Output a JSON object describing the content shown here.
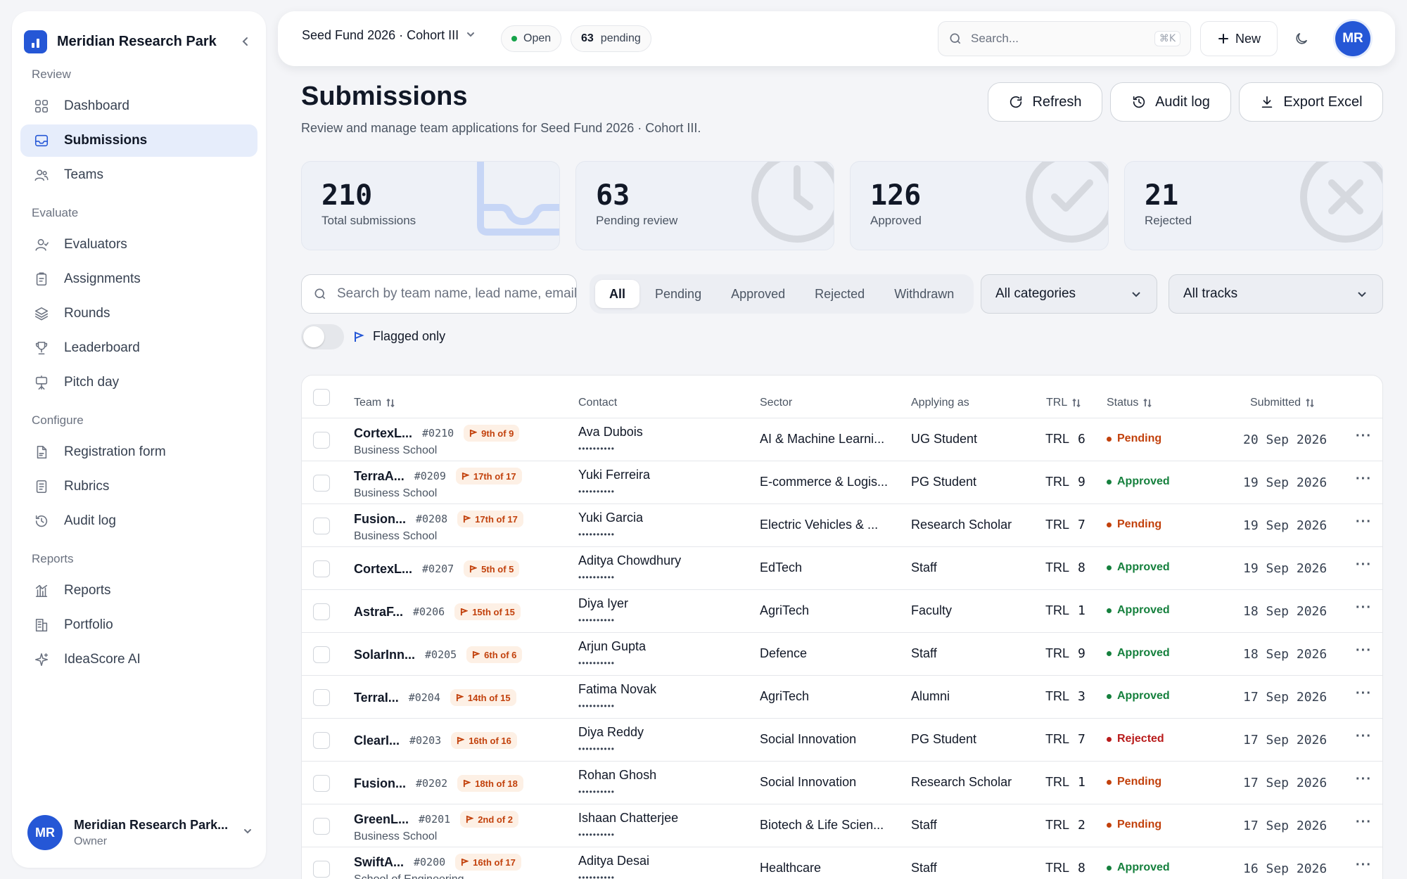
{
  "sidebar": {
    "brand": "Meridian Research Park",
    "groups": [
      {
        "label": "Review",
        "items": [
          {
            "label": "Dashboard",
            "icon": "dashboard-icon",
            "active": false
          },
          {
            "label": "Submissions",
            "icon": "inbox-icon",
            "active": true
          },
          {
            "label": "Teams",
            "icon": "users-icon",
            "active": false
          }
        ]
      },
      {
        "label": "Evaluate",
        "items": [
          {
            "label": "Evaluators",
            "icon": "user-icon",
            "active": false
          },
          {
            "label": "Assignments",
            "icon": "clipboard-icon",
            "active": false
          },
          {
            "label": "Rounds",
            "icon": "layers-icon",
            "active": false
          },
          {
            "label": "Leaderboard",
            "icon": "trophy-icon",
            "active": false
          },
          {
            "label": "Pitch day",
            "icon": "presentation-icon",
            "active": false
          }
        ]
      },
      {
        "label": "Configure",
        "items": [
          {
            "label": "Registration form",
            "icon": "form-icon",
            "active": false
          },
          {
            "label": "Rubrics",
            "icon": "rubric-icon",
            "active": false
          },
          {
            "label": "Audit log",
            "icon": "history-icon",
            "active": false
          }
        ]
      },
      {
        "label": "Reports",
        "items": [
          {
            "label": "Reports",
            "icon": "chart-icon",
            "active": false
          },
          {
            "label": "Portfolio",
            "icon": "building-icon",
            "active": false
          },
          {
            "label": "IdeaScore AI",
            "icon": "sparkle-icon",
            "active": false
          }
        ]
      }
    ],
    "profile": {
      "initials": "MR",
      "name": "Meridian Research Park...",
      "role": "Owner"
    }
  },
  "topbar": {
    "fund": "Seed Fund 2026 · Cohort III",
    "status": "Open",
    "pending_count": "63",
    "pending_label": "pending",
    "search_placeholder": "Search...",
    "shortcut": "⌘K",
    "new_label": "New",
    "avatar": "MR"
  },
  "header": {
    "title": "Submissions",
    "subtitle": "Review and manage team applications for Seed Fund 2026 · Cohort III.",
    "refresh": "Refresh",
    "audit": "Audit log",
    "export": "Export Excel"
  },
  "stats": [
    {
      "value": "210",
      "label": "Total submissions"
    },
    {
      "value": "63",
      "label": "Pending review"
    },
    {
      "value": "126",
      "label": "Approved"
    },
    {
      "value": "21",
      "label": "Rejected"
    }
  ],
  "filters": {
    "search_placeholder": "Search by team name, lead name, email",
    "tabs": [
      "All",
      "Pending",
      "Approved",
      "Rejected",
      "Withdrawn"
    ],
    "active_tab": "All",
    "category": "All categories",
    "track": "All tracks",
    "flagged_label": "Flagged only"
  },
  "table": {
    "columns": {
      "team": "Team",
      "contact": "Contact",
      "sector": "Sector",
      "applying": "Applying as",
      "trl": "TRL",
      "status": "Status",
      "submitted": "Submitted"
    },
    "status_colors": {
      "Pending": "#c2410c",
      "Approved": "#15803d",
      "Rejected": "#b91c1c"
    },
    "rows": [
      {
        "team": "CortexL...",
        "id": "#0210",
        "rank": "9th of 9",
        "school": "Business School",
        "contact": "Ava Dubois",
        "mask": "••••••••••",
        "sector": "AI & Machine Learni...",
        "applying": "UG Student",
        "trl_label": "TRL",
        "trl": "6",
        "status": "Pending",
        "date": "20 Sep 2026"
      },
      {
        "team": "TerraA...",
        "id": "#0209",
        "rank": "17th of 17",
        "school": "Business School",
        "contact": "Yuki Ferreira",
        "mask": "••••••••••",
        "sector": "E-commerce & Logis...",
        "applying": "PG Student",
        "trl_label": "TRL",
        "trl": "9",
        "status": "Approved",
        "date": "19 Sep 2026"
      },
      {
        "team": "Fusion...",
        "id": "#0208",
        "rank": "17th of 17",
        "school": "Business School",
        "contact": "Yuki Garcia",
        "mask": "••••••••••",
        "sector": "Electric Vehicles & ...",
        "applying": "Research Scholar",
        "trl_label": "TRL",
        "trl": "7",
        "status": "Pending",
        "date": "19 Sep 2026"
      },
      {
        "team": "CortexL...",
        "id": "#0207",
        "rank": "5th of 5",
        "school": "",
        "contact": "Aditya Chowdhury",
        "mask": "••••••••••",
        "sector": "EdTech",
        "applying": "Staff",
        "trl_label": "TRL",
        "trl": "8",
        "status": "Approved",
        "date": "19 Sep 2026"
      },
      {
        "team": "AstraF...",
        "id": "#0206",
        "rank": "15th of 15",
        "school": "",
        "contact": "Diya Iyer",
        "mask": "••••••••••",
        "sector": "AgriTech",
        "applying": "Faculty",
        "trl_label": "TRL",
        "trl": "1",
        "status": "Approved",
        "date": "18 Sep 2026"
      },
      {
        "team": "SolarInn...",
        "id": "#0205",
        "rank": "6th of 6",
        "school": "",
        "contact": "Arjun Gupta",
        "mask": "••••••••••",
        "sector": "Defence",
        "applying": "Staff",
        "trl_label": "TRL",
        "trl": "9",
        "status": "Approved",
        "date": "18 Sep 2026"
      },
      {
        "team": "TerraI...",
        "id": "#0204",
        "rank": "14th of 15",
        "school": "",
        "contact": "Fatima Novak",
        "mask": "••••••••••",
        "sector": "AgriTech",
        "applying": "Alumni",
        "trl_label": "TRL",
        "trl": "3",
        "status": "Approved",
        "date": "17 Sep 2026"
      },
      {
        "team": "ClearI...",
        "id": "#0203",
        "rank": "16th of 16",
        "school": "",
        "contact": "Diya Reddy",
        "mask": "••••••••••",
        "sector": "Social Innovation",
        "applying": "PG Student",
        "trl_label": "TRL",
        "trl": "7",
        "status": "Rejected",
        "date": "17 Sep 2026"
      },
      {
        "team": "Fusion...",
        "id": "#0202",
        "rank": "18th of 18",
        "school": "",
        "contact": "Rohan Ghosh",
        "mask": "••••••••••",
        "sector": "Social Innovation",
        "applying": "Research Scholar",
        "trl_label": "TRL",
        "trl": "1",
        "status": "Pending",
        "date": "17 Sep 2026"
      },
      {
        "team": "GreenL...",
        "id": "#0201",
        "rank": "2nd of 2",
        "school": "Business School",
        "contact": "Ishaan Chatterjee",
        "mask": "••••••••••",
        "sector": "Biotech & Life Scien...",
        "applying": "Staff",
        "trl_label": "TRL",
        "trl": "2",
        "status": "Pending",
        "date": "17 Sep 2026"
      },
      {
        "team": "SwiftA...",
        "id": "#0200",
        "rank": "16th of 17",
        "school": "School of Engineering",
        "contact": "Aditya Desai",
        "mask": "••••••••••",
        "sector": "Healthcare",
        "applying": "Staff",
        "trl_label": "TRL",
        "trl": "8",
        "status": "Approved",
        "date": "16 Sep 2026"
      }
    ]
  }
}
